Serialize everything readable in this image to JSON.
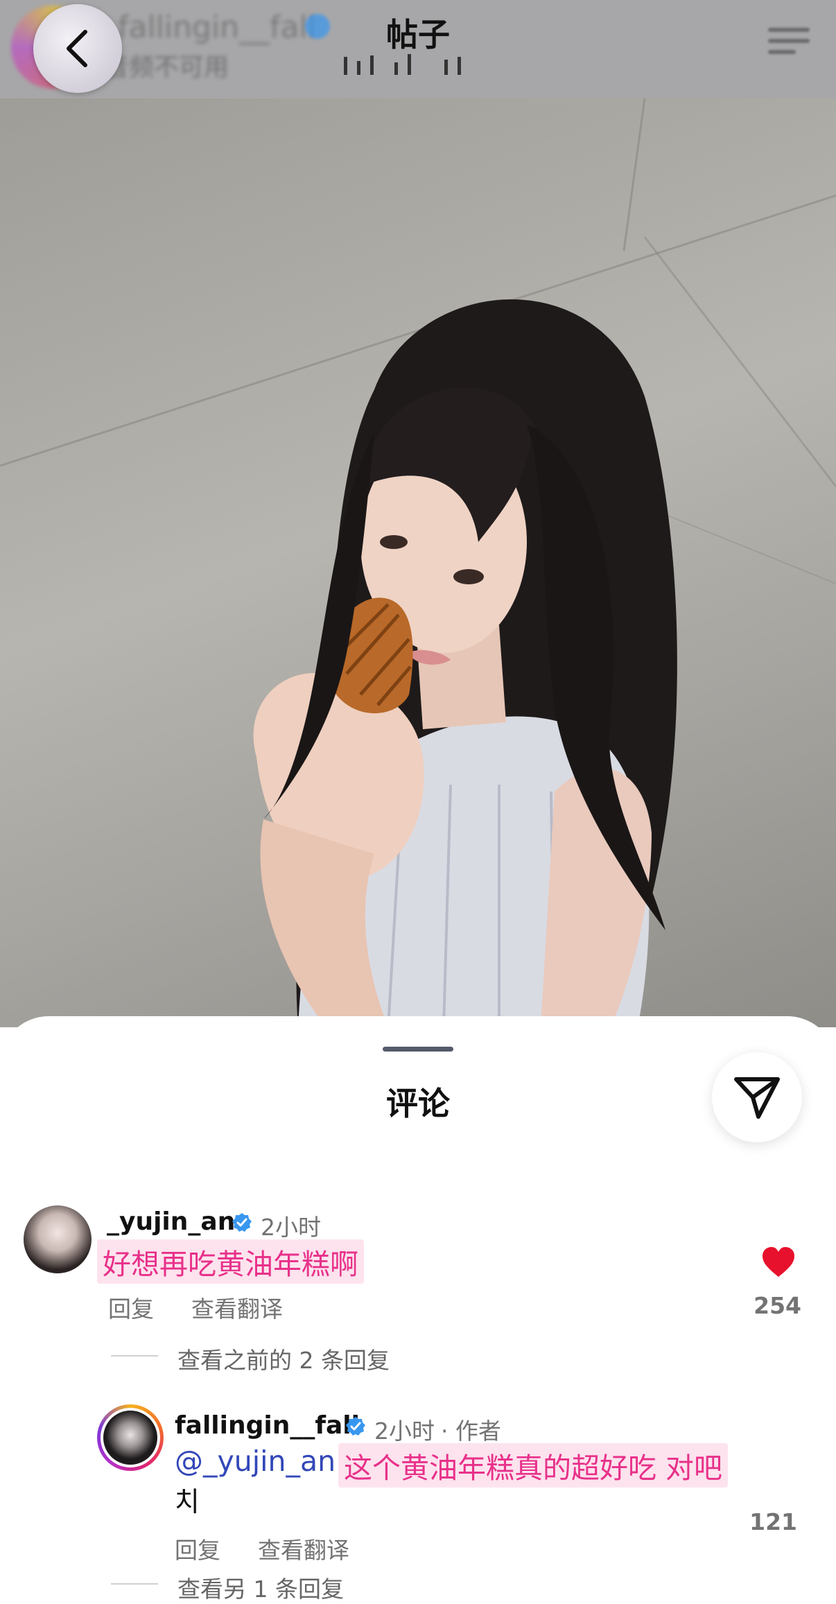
{
  "header": {
    "title": "帖子",
    "username": "fallingin__fall",
    "subtitle": "音频不可用"
  },
  "sheet": {
    "title": "评论"
  },
  "comments": [
    {
      "username": "_yujin_an",
      "verified": true,
      "time": "2小时",
      "text": "好想再吃黄油年糕啊",
      "reply_label": "回复",
      "translate_label": "查看翻译",
      "likes": "254",
      "liked": true,
      "view_replies": "查看之前的 2 条回复"
    },
    {
      "username": "fallingin__fall",
      "verified": true,
      "time": "2小时",
      "author_tag": "· 作者",
      "mention": "@_yujin_an",
      "text": "这个黄油年糕真的超好吃 对吧",
      "text_line2": "치",
      "reply_label": "回复",
      "translate_label": "查看翻译",
      "likes": "121",
      "view_replies": "查看另 1 条回复"
    }
  ],
  "colors": {
    "highlight_text": "#e8318a",
    "highlight_bg": "#fde3ee",
    "mention": "#3247b8",
    "verified": "#3897f0",
    "heart": "#e8112d"
  },
  "icons": [
    "back-chevron-icon",
    "menu-icon",
    "share-send-icon",
    "verified-badge-icon",
    "heart-icon"
  ]
}
